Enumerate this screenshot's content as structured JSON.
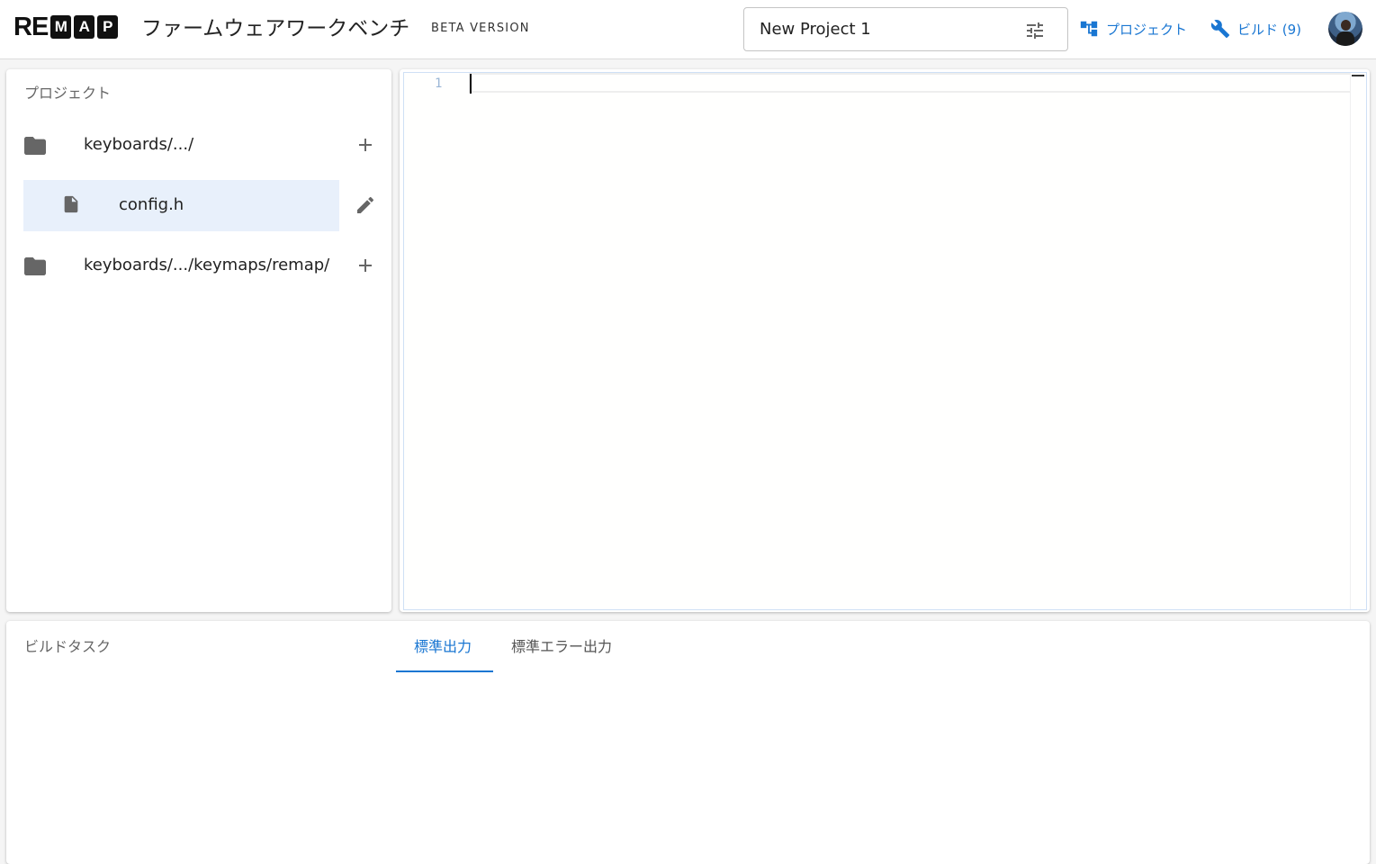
{
  "header": {
    "logo": {
      "plain": "RE",
      "boxed": [
        "M",
        "A",
        "P"
      ]
    },
    "app_title": "ファームウェアワークベンチ",
    "badge": "BETA VERSION",
    "project_name": "New Project 1",
    "project_settings_icon": "tune-icon",
    "nav": {
      "project_label": "プロジェクト",
      "project_icon": "account-tree-icon",
      "build_label": "ビルド (9)",
      "build_icon": "wrench-icon"
    },
    "accent_color": "#1976d2"
  },
  "project_panel": {
    "title": "プロジェクト",
    "items": [
      {
        "type": "folder",
        "label": "keyboards/.../",
        "icon": "folder-icon",
        "action_icon": "add-icon"
      },
      {
        "type": "file",
        "label": "config.h",
        "icon": "file-icon",
        "action_icon": "edit-icon",
        "selected": true
      },
      {
        "type": "folder",
        "label": "keyboards/.../keymaps/remap/",
        "icon": "folder-icon",
        "action_icon": "add-icon"
      }
    ]
  },
  "editor": {
    "line_numbers": [
      "1"
    ],
    "content": ""
  },
  "build_panel": {
    "title": "ビルドタスク",
    "tabs": [
      {
        "label": "標準出力",
        "active": true
      },
      {
        "label": "標準エラー出力",
        "active": false
      }
    ]
  }
}
